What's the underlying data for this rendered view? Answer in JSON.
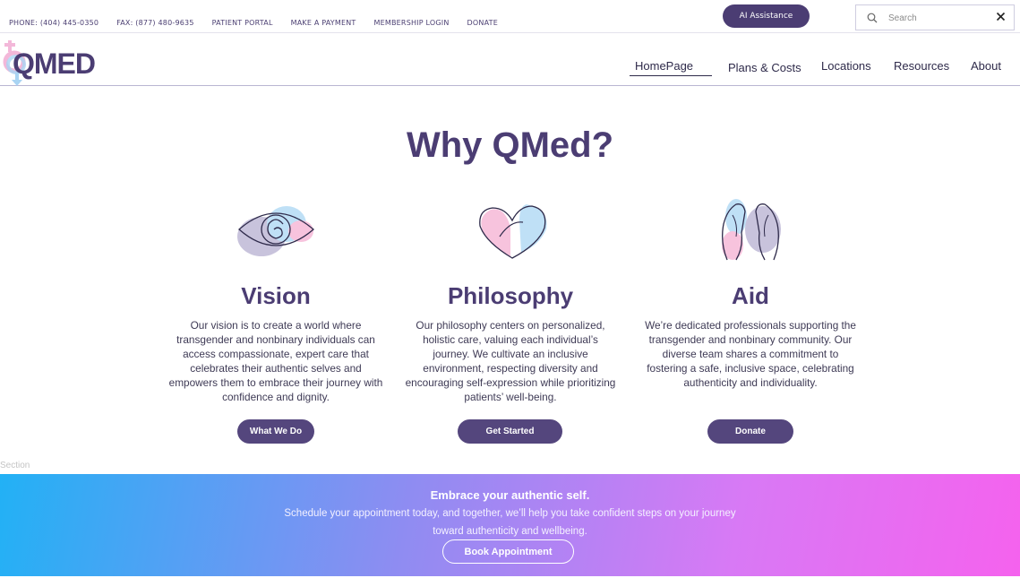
{
  "topbar": {
    "links": [
      "PHONE: (404) 445-0350",
      "FAX: (877) 480-9635",
      "PATIENT PORTAL",
      "MAKE A PAYMENT",
      "MEMBERSHIP LOGIN",
      "DONATE"
    ],
    "ai_button": "AI Assistance",
    "search_placeholder": "Search"
  },
  "logo": {
    "text": "QMED"
  },
  "nav": {
    "items": [
      "HomePage",
      "Plans & Costs",
      "Locations",
      "Resources",
      "About"
    ],
    "active": "HomePage"
  },
  "main": {
    "heading": "Why QMed?",
    "cards": [
      {
        "title": "Vision",
        "icon": "eye-icon",
        "text": "Our vision is to create a world where transgender and nonbinary individuals can access compassionate, expert care that celebrates their authentic selves and empowers them to embrace their journey with confidence and dignity.",
        "button": "What We Do"
      },
      {
        "title": "Philosophy",
        "icon": "heart-icon",
        "text": "Our philosophy centers on personalized, holistic care, valuing each individual’s journey. We cultivate an inclusive environment, respecting diversity and encouraging self-expression while prioritizing patients’ well-being.",
        "button": "Get Started"
      },
      {
        "title": "Aid",
        "icon": "hands-icon",
        "text": "We’re dedicated professionals supporting the transgender and nonbinary community. Our diverse team shares a commitment to fostering a safe, inclusive space, celebrating authenticity and individuality.",
        "button": "Donate"
      }
    ]
  },
  "section_label": "Section",
  "banner": {
    "title": "Embrace your authentic self.",
    "text": "Schedule your appointment today, and together, we’ll help you take confident steps on your journey toward authenticity and wellbeing.",
    "button": "Book Appointment"
  },
  "colors": {
    "brand": "#4b3d73",
    "button": "#54467d",
    "gradient_start": "#22b1f5",
    "gradient_end": "#f562ee"
  }
}
